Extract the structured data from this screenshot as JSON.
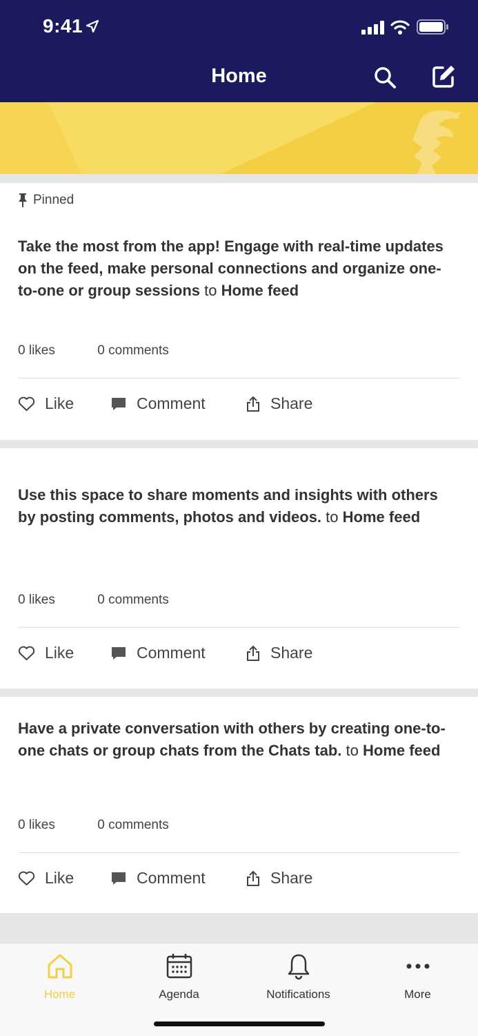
{
  "status_bar": {
    "time": "9:41"
  },
  "header": {
    "title": "Home"
  },
  "colors": {
    "header_bg": "#1b1a5e",
    "accent": "#f4cf44"
  },
  "posts": [
    {
      "pinned_label": "Pinned",
      "text": "Take the most from the app! Engage with real-time updates on the feed, make personal connections and organize one-to-one or group sessions",
      "to_word": "to",
      "destination": "Home feed",
      "likes": "0 likes",
      "comments": "0 comments"
    },
    {
      "text": "Use this space to share moments and insights with others by posting comments, photos and videos.",
      "to_word": "to",
      "destination": "Home feed",
      "likes": "0 likes",
      "comments": "0 comments"
    },
    {
      "text": "Have a private conversation with others by creating one-to-one chats or group chats from the Chats tab.",
      "to_word": "to",
      "destination": "Home feed",
      "likes": "0 likes",
      "comments": "0 comments"
    }
  ],
  "actions": {
    "like": "Like",
    "comment": "Comment",
    "share": "Share"
  },
  "tabs": [
    {
      "label": "Home",
      "icon": "home-icon",
      "active": true
    },
    {
      "label": "Agenda",
      "icon": "calendar-icon"
    },
    {
      "label": "Notifications",
      "icon": "bell-icon"
    },
    {
      "label": "More",
      "icon": "more-icon"
    }
  ]
}
